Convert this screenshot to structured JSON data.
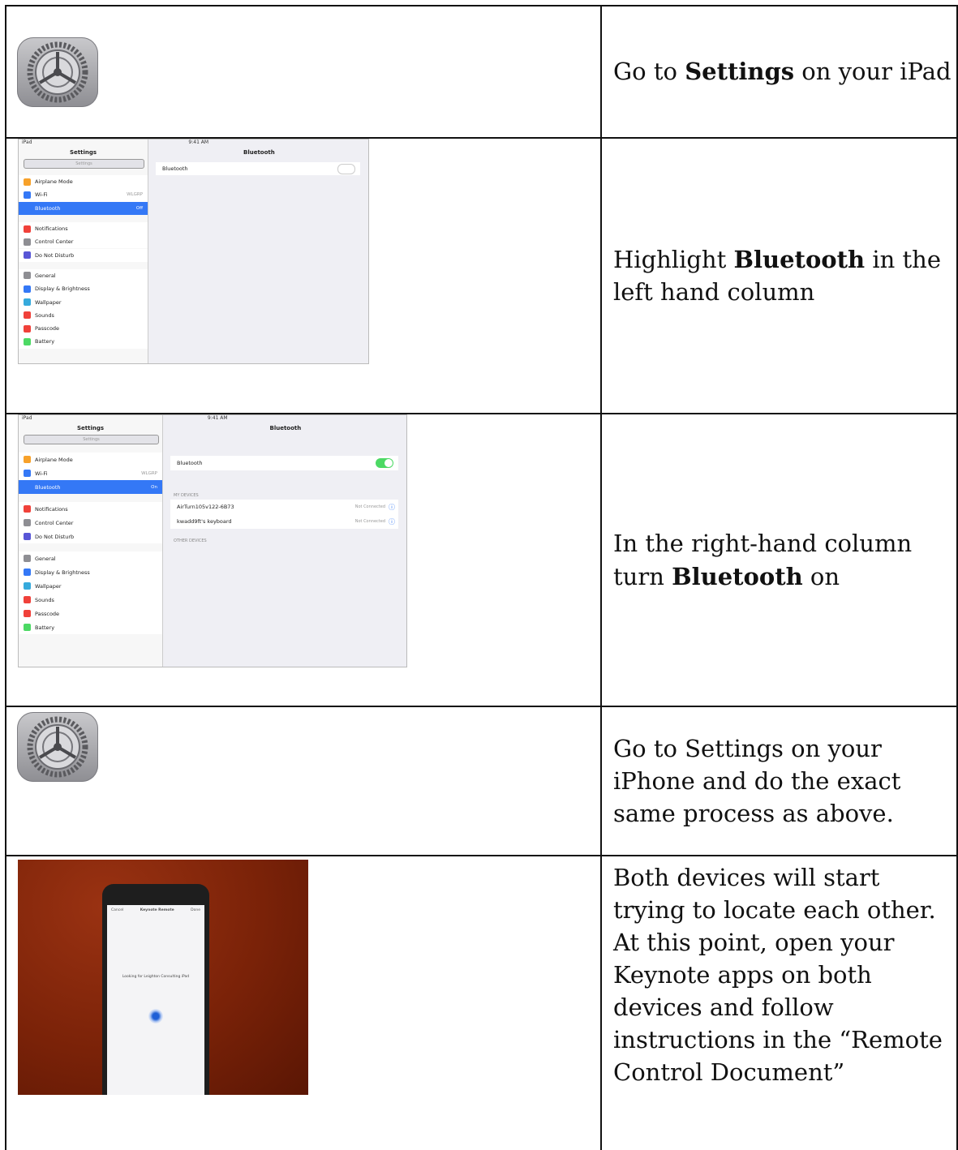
{
  "rows": [
    {
      "html": "Go to <b>Settings</b> on your iPad"
    },
    {
      "html": "Highlight <b>Bluetooth</b> in the left hand column"
    },
    {
      "html": "In the right-hand column turn <b>Bluetooth</b> on"
    },
    {
      "html": "Go to Settings on your iPhone and do the exact same process as above."
    },
    {
      "html": "Both devices will start trying to locate each other. At this point, open your Keynote apps on both devices and follow instructions in the “Remote Control Document”"
    }
  ],
  "ipad1": {
    "status_left": "iPad",
    "status_time": "9:41 AM",
    "sidebar_title": "Settings",
    "search_placeholder": "Settings",
    "main_title": "Bluetooth",
    "bluetooth_label": "Bluetooth",
    "items": [
      {
        "label": "Airplane Mode",
        "value": "",
        "color": "#f7a12a"
      },
      {
        "label": "Wi-Fi",
        "value": "WLGRP",
        "color": "#3478f6"
      },
      {
        "label": "Bluetooth",
        "value": "Off",
        "color": "#3478f6",
        "selected": true
      },
      {
        "label": "Notifications",
        "value": "",
        "color": "#f0413a"
      },
      {
        "label": "Control Center",
        "value": "",
        "color": "#8e8e93"
      },
      {
        "label": "Do Not Disturb",
        "value": "",
        "color": "#5856d6"
      },
      {
        "label": "General",
        "value": "",
        "color": "#8e8e93"
      },
      {
        "label": "Display & Brightness",
        "value": "",
        "color": "#3478f6"
      },
      {
        "label": "Wallpaper",
        "value": "",
        "color": "#36aadc"
      },
      {
        "label": "Sounds",
        "value": "",
        "color": "#f0413a"
      },
      {
        "label": "Passcode",
        "value": "",
        "color": "#f0413a"
      },
      {
        "label": "Battery",
        "value": "",
        "color": "#4cd964"
      }
    ]
  },
  "ipad2": {
    "status_left": "iPad",
    "status_time": "9:41 AM",
    "sidebar_title": "Settings",
    "search_placeholder": "Settings",
    "main_title": "Bluetooth",
    "bluetooth_label": "Bluetooth",
    "devices": [
      {
        "name": "AirTurn105v122-6B73",
        "status": "Not Connected"
      },
      {
        "name": "kwadd9ft's keyboard",
        "status": "Not Connected"
      }
    ],
    "my_devices_label": "MY DEVICES",
    "other_devices_label": "OTHER DEVICES",
    "items": [
      {
        "label": "Airplane Mode",
        "value": "",
        "color": "#f7a12a"
      },
      {
        "label": "Wi-Fi",
        "value": "WLGRP",
        "color": "#3478f6"
      },
      {
        "label": "Bluetooth",
        "value": "On",
        "color": "#3478f6",
        "selected": true
      },
      {
        "label": "Notifications",
        "value": "",
        "color": "#f0413a"
      },
      {
        "label": "Control Center",
        "value": "",
        "color": "#8e8e93"
      },
      {
        "label": "Do Not Disturb",
        "value": "",
        "color": "#5856d6"
      },
      {
        "label": "General",
        "value": "",
        "color": "#8e8e93"
      },
      {
        "label": "Display & Brightness",
        "value": "",
        "color": "#3478f6"
      },
      {
        "label": "Wallpaper",
        "value": "",
        "color": "#36aadc"
      },
      {
        "label": "Sounds",
        "value": "",
        "color": "#f0413a"
      },
      {
        "label": "Passcode",
        "value": "",
        "color": "#f0413a"
      },
      {
        "label": "Battery",
        "value": "",
        "color": "#4cd964"
      }
    ]
  },
  "phone": {
    "cancel": "Cancel",
    "title": "Keynote Remote",
    "done": "Done",
    "message": "Looking for Leighton Consulting iPad"
  }
}
